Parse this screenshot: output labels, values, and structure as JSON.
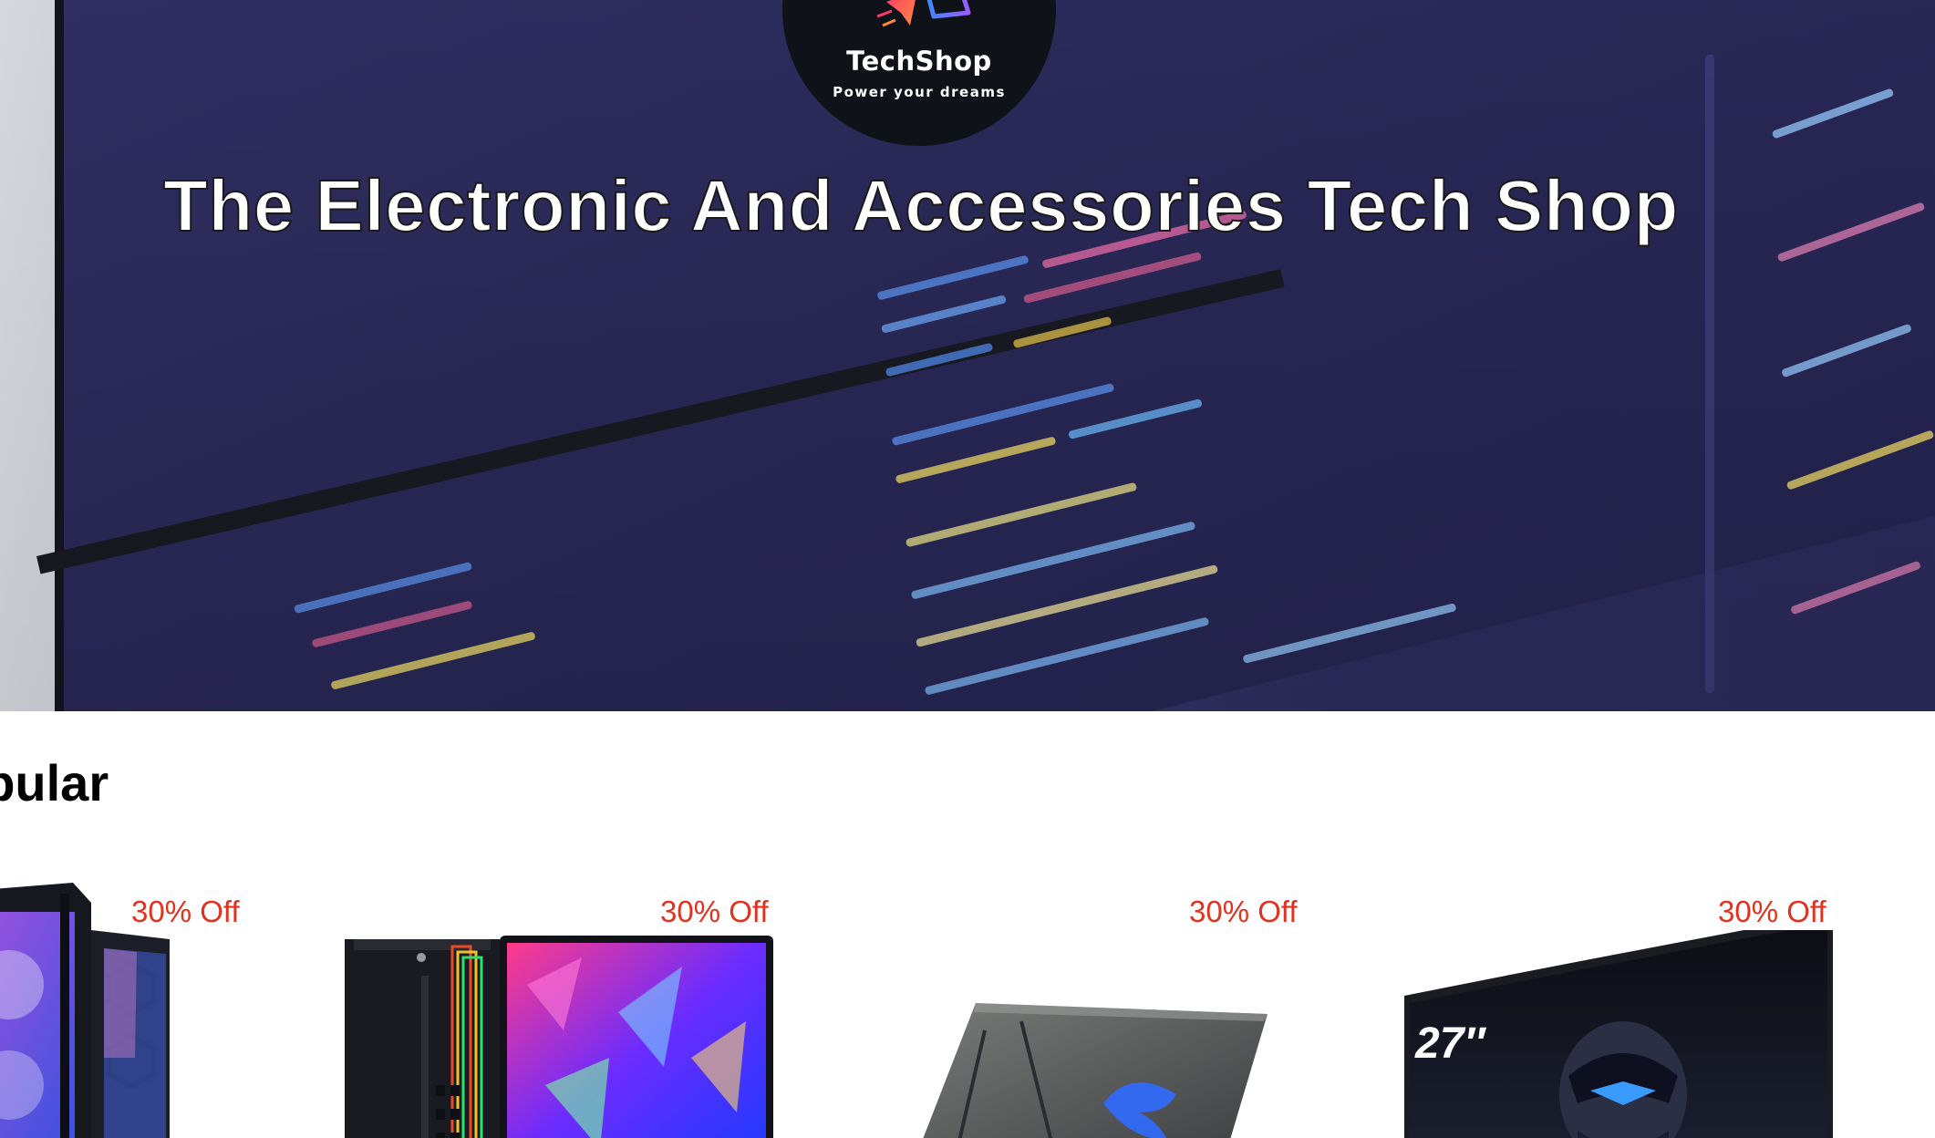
{
  "brand": {
    "name": "TechShop",
    "tagline": "Power your dreams",
    "logo_icon": "paper-plane-icon"
  },
  "hero": {
    "title": "The Electronic And Accessories Tech Shop"
  },
  "popular": {
    "heading": "opular",
    "products": [
      {
        "discount": "30% Off",
        "image": "gaming-pc-tower-rgb"
      },
      {
        "discount": "30% Off",
        "image": "desktop-pc-with-monitor"
      },
      {
        "discount": "30% Off",
        "image": "gaming-laptop"
      },
      {
        "discount": "30% Off",
        "image": "curved-gaming-monitor"
      }
    ]
  },
  "colors": {
    "discount_text": "#e0321f",
    "logo_background": "#0f1218",
    "hero_monitor": "#2d2c5e"
  }
}
